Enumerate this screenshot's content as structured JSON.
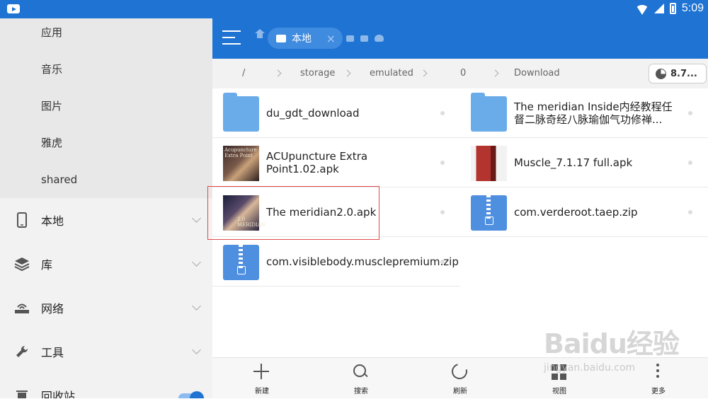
{
  "status_bar": {
    "time": "5:09"
  },
  "drawer": {
    "sub_items": [
      "应用",
      "音乐",
      "图片",
      "雅虎",
      "shared"
    ],
    "nav_items": [
      {
        "label": "本地",
        "icon": "phone-icon"
      },
      {
        "label": "库",
        "icon": "layers-icon"
      },
      {
        "label": "网络",
        "icon": "router-icon"
      },
      {
        "label": "工具",
        "icon": "wrench-icon"
      },
      {
        "label": "回收站",
        "icon": "trash-icon"
      }
    ]
  },
  "appbar": {
    "tab_label": "本地",
    "tab_close": "×"
  },
  "pathbar": {
    "crumbs": [
      "/",
      "storage",
      "emulated",
      "0",
      "Download"
    ],
    "storage_label": "8.7..."
  },
  "files": [
    {
      "name": "du_gdt_download",
      "type": "folder"
    },
    {
      "name": "The meridian Inside内经教程任督二脉奇经八脉瑜伽气功修禅...",
      "type": "folder"
    },
    {
      "name": "ACUpuncture Extra Point1.02.apk",
      "type": "apk",
      "thumb_text": "Acupuncture Extra Point"
    },
    {
      "name": "Muscle_7.1.17 full.apk",
      "type": "apk"
    },
    {
      "name": "The meridian2.0.apk",
      "type": "apk",
      "thumb_text": "2.0 MERIDIAN"
    },
    {
      "name": "com.verderoot.taep.zip",
      "type": "zip"
    },
    {
      "name": "com.visiblebody.musclepremium.zip",
      "type": "zip"
    }
  ],
  "bottom_bar": {
    "new": "新建",
    "search": "搜索",
    "refresh": "刷新",
    "view": "视图",
    "more": "更多"
  },
  "watermark": {
    "logo": "Baidu经验",
    "url": "jingyan.baidu.com"
  },
  "colors": {
    "accent": "#1e73d3",
    "highlight": "#e04b4b"
  }
}
